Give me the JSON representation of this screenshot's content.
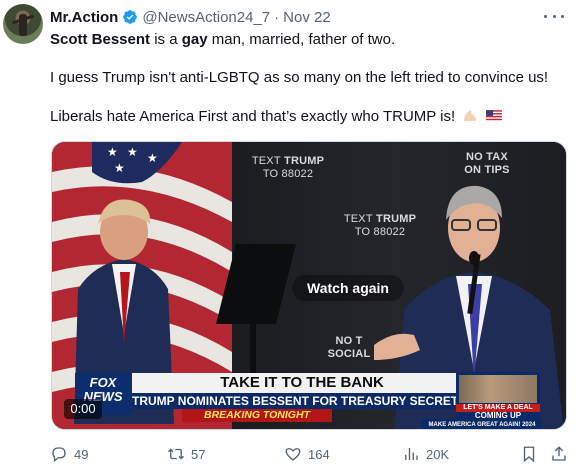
{
  "tweet": {
    "author_name": "Mr.Action",
    "handle": "@NewsAction24_7",
    "separator": "·",
    "date": "Nov 22",
    "line1_bold": "Scott Bessent",
    "line1_mid": " is a ",
    "line1_bold2": "gay",
    "line1_rest": " man, married, father of two.",
    "line2": "I guess Trump isn't anti-LGBTQ as so many on the left tried to convince us!",
    "line3": "Liberals hate America First and that’s exactly who TRUMP is!"
  },
  "media": {
    "sign_text_trump_1": "TEXT",
    "sign_trump_1": "TRUMP",
    "sign_num_1": "TO 88022",
    "sign_no_tax_1": "NO TAX",
    "sign_no_tax_2": "ON TIPS",
    "sign_text_trump_2": "TEXT",
    "sign_trump_2": "TRUMP",
    "sign_num_2": "TO 88022",
    "sign_no_social_1": "NO T",
    "sign_no_social_2": "SOCIAL",
    "sign_so": "SO",
    "watch_again": "Watch again",
    "fox_logo": "FOX NEWS",
    "lt_headline": "TAKE IT TO THE BANK",
    "lt_sub": "TRUMP NOMINATES BESSENT FOR TREASURY SECRETARY",
    "lt_breaking": "BREAKING TONIGHT",
    "promo_line1": "LET'S MAKE A DEAL",
    "promo_line2": "COMING UP",
    "ticker": "MAKE AMERICA GREAT AGAIN! 2024",
    "time": "0:00"
  },
  "actions": {
    "replies": "49",
    "reposts": "57",
    "likes": "164",
    "views": "20K"
  }
}
